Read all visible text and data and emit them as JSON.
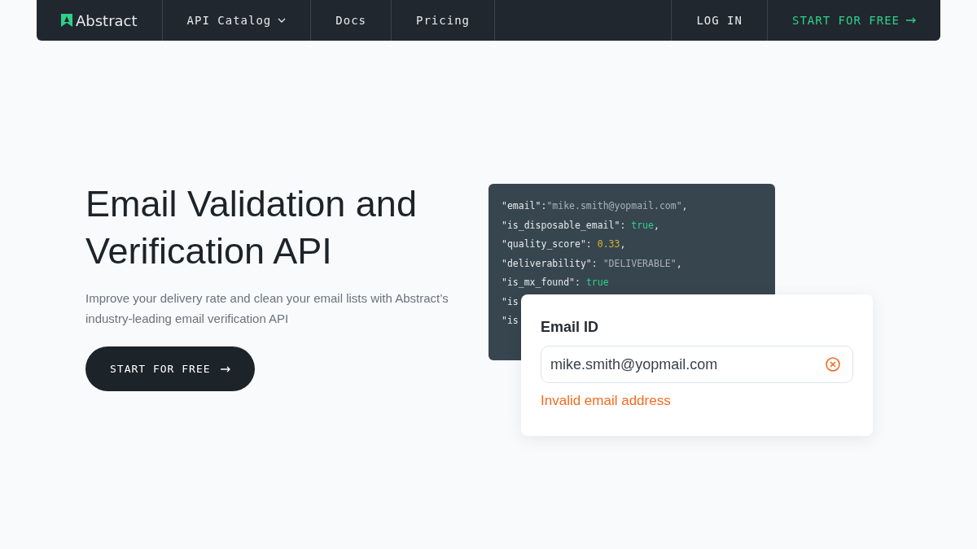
{
  "nav": {
    "logo": "Abstract",
    "items": [
      {
        "label": "API Catalog",
        "dropdown": true
      },
      {
        "label": "Docs",
        "dropdown": false
      },
      {
        "label": "Pricing",
        "dropdown": false
      }
    ],
    "login": "LOG IN",
    "cta": "START FOR FREE"
  },
  "hero": {
    "title": "Email Validation and Verification API",
    "subtitle": "Improve your delivery rate and clean your email lists with Abstract’s industry-leading email verification API",
    "button": "START FOR FREE"
  },
  "code": {
    "lines": [
      [
        {
          "text": "\"email\"",
          "kind": "key"
        },
        {
          "text": ":",
          "kind": "punct"
        },
        {
          "text": "\"mike.smith@yopmail.com\"",
          "kind": "string"
        },
        {
          "text": ",",
          "kind": "punct"
        }
      ],
      [
        {
          "text": "\"is_disposable_email\"",
          "kind": "key"
        },
        {
          "text": ": ",
          "kind": "punct"
        },
        {
          "text": "true",
          "kind": "bool"
        },
        {
          "text": ",",
          "kind": "punct"
        }
      ],
      [
        {
          "text": "\"quality_score\"",
          "kind": "key"
        },
        {
          "text": ": ",
          "kind": "punct"
        },
        {
          "text": "0.33",
          "kind": "number"
        },
        {
          "text": ",",
          "kind": "punct"
        }
      ],
      [
        {
          "text": "\"deliverability\"",
          "kind": "key"
        },
        {
          "text": ": ",
          "kind": "punct"
        },
        {
          "text": "\"DELIVERABLE\"",
          "kind": "string"
        },
        {
          "text": ",",
          "kind": "punct"
        }
      ],
      [
        {
          "text": "\"is_mx_found\"",
          "kind": "key"
        },
        {
          "text": ": ",
          "kind": "punct"
        },
        {
          "text": "true",
          "kind": "bool"
        }
      ],
      [
        {
          "text": "\"is",
          "kind": "key"
        }
      ],
      [
        {
          "text": "\"is",
          "kind": "key"
        }
      ]
    ]
  },
  "form": {
    "label": "Email ID",
    "value": "mike.smith@yopmail.com",
    "invalid": true,
    "error": "Invalid email address"
  }
}
